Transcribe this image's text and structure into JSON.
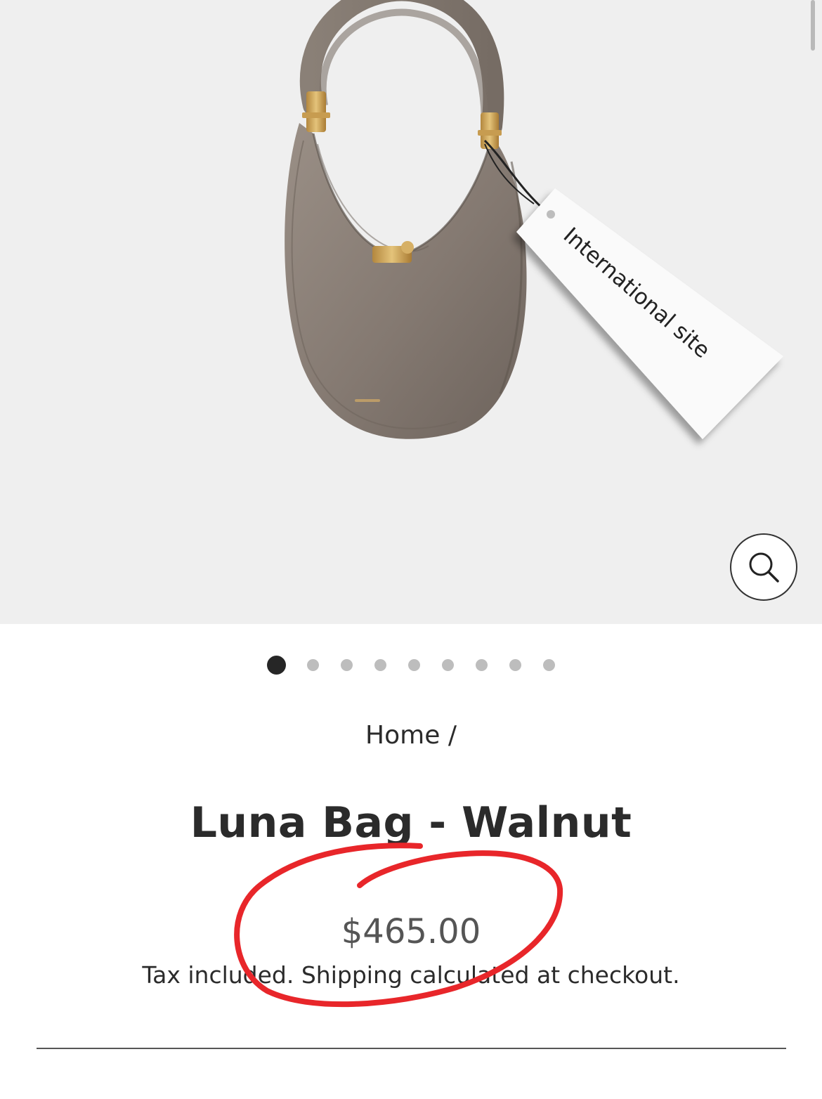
{
  "product_image": {
    "tag_text": "International site",
    "zoom_icon": "search-icon",
    "background_color": "#efefef",
    "bag_color": "#8a7e75"
  },
  "carousel": {
    "total_slides": 9,
    "active_index": 0
  },
  "breadcrumb": {
    "home_label": "Home",
    "separator": "/"
  },
  "product": {
    "title": "Luna Bag - Walnut",
    "price": "$465.00",
    "tax_note": "Tax included. Shipping calculated at checkout."
  },
  "annotation": {
    "color": "#e8262a",
    "shape": "hand-drawn circle around price"
  }
}
